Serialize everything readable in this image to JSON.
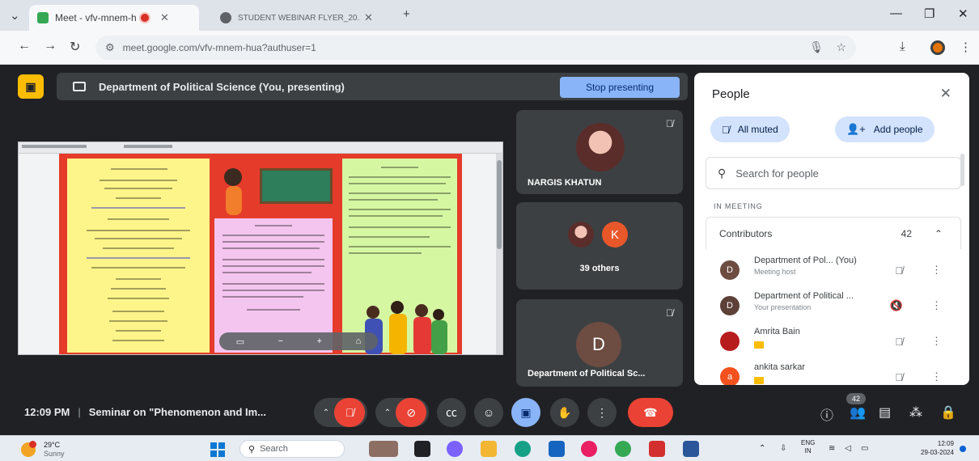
{
  "browser": {
    "tabs": [
      {
        "title": "Meet - vfv-mnem-hua",
        "active": true
      },
      {
        "title": "STUDENT WEBINAR FLYER_20...",
        "active": false
      }
    ],
    "url": "meet.google.com/vfv-mnem-hua?authuser=1"
  },
  "meet": {
    "presenting_label": "Department of Political Science (You, presenting)",
    "stop_presenting": "Stop presenting",
    "tiles": [
      {
        "name": "NARGIS KHATUN",
        "muted": true
      },
      {
        "name": "39 others",
        "letter": "K"
      },
      {
        "name": "Department of Political Sc...",
        "letter": "D",
        "muted": true
      }
    ]
  },
  "people_panel": {
    "title": "People",
    "all_muted": "All muted",
    "add_people": "Add people",
    "search_placeholder": "Search for people",
    "section": "IN MEETING",
    "group_name": "Contributors",
    "group_count": "42",
    "participants": [
      {
        "letter": "D",
        "name": "Department of Pol... (You)",
        "sub": "Meeting host",
        "color": "#6d4c41"
      },
      {
        "letter": "D",
        "name": "Department of Political ...",
        "sub": "Your presentation",
        "color": "#5d4037"
      },
      {
        "letter": "",
        "name": "Amrita Bain",
        "sub": "",
        "color": "#b71c1c"
      },
      {
        "letter": "a",
        "name": "ankita sarkar",
        "sub": "",
        "color": "#f4511e"
      }
    ]
  },
  "bottom_bar": {
    "time": "12:09 PM",
    "meeting_title": "Seminar on \"Phenomenon and Im...",
    "participant_badge": "42"
  },
  "taskbar": {
    "temperature": "29°C",
    "weather": "Sunny",
    "search": "Search",
    "lang_top": "ENG",
    "lang_bottom": "IN",
    "time": "12:09",
    "date": "29-03-2024"
  },
  "colors": {
    "meet_bg": "#202124",
    "accent_blue": "#8ab4f8",
    "end_call_red": "#ea4335",
    "presenter_yellow": "#fbbc04"
  }
}
